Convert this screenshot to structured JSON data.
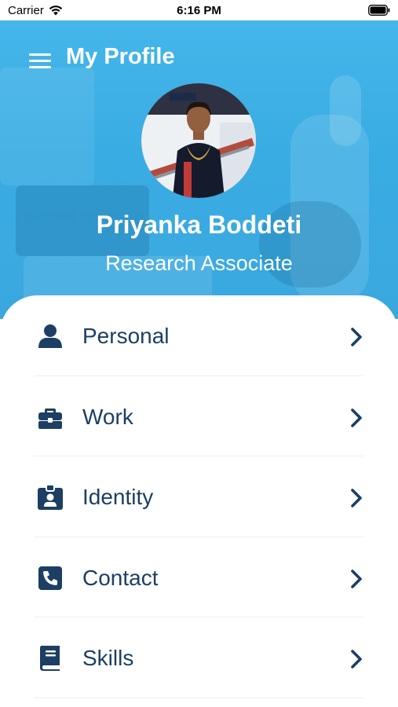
{
  "status_bar": {
    "carrier": "Carrier",
    "time": "6:16 PM"
  },
  "header": {
    "title": "My Profile",
    "menu_icon": "hamburger-menu-icon",
    "background_color": "#3aabe2"
  },
  "profile": {
    "name": "Priyanka Boddeti",
    "role": "Research Associate"
  },
  "menu": {
    "text_color": "#1c3f63",
    "items": [
      {
        "label": "Personal",
        "icon": "user-icon"
      },
      {
        "label": "Work",
        "icon": "briefcase-icon"
      },
      {
        "label": "Identity",
        "icon": "id-badge-icon"
      },
      {
        "label": "Contact",
        "icon": "phone-icon"
      },
      {
        "label": "Skills",
        "icon": "book-icon"
      }
    ]
  }
}
